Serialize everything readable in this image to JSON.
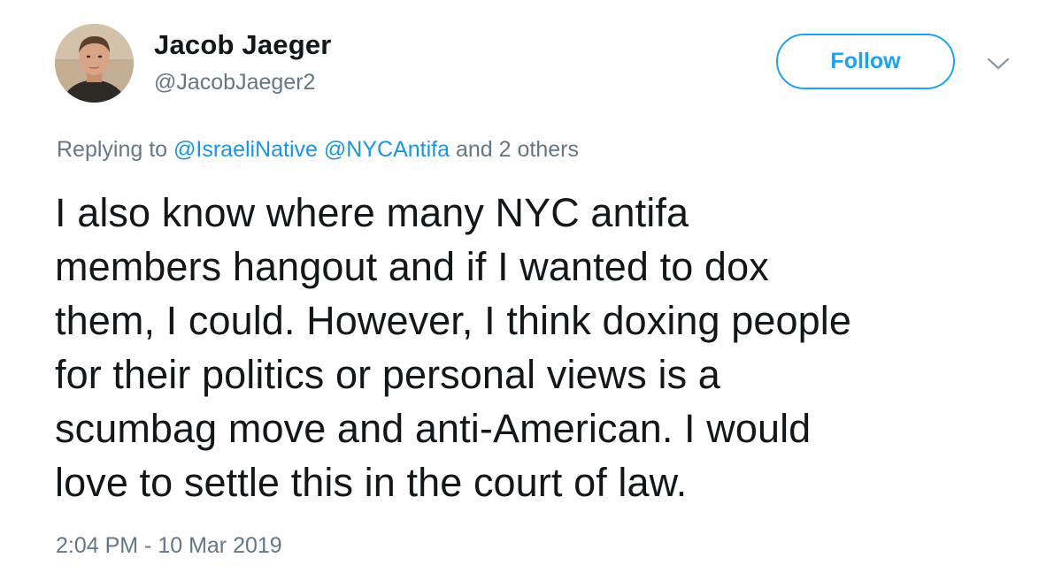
{
  "author": {
    "name": "Jacob Jaeger",
    "handle": "@JacobJaeger2",
    "avatar_icon": "user-avatar-photo"
  },
  "actions": {
    "follow_label": "Follow",
    "more_icon": "chevron-down-icon"
  },
  "reply": {
    "prefix": "Replying to",
    "mentions": [
      "@IsraeliNative",
      "@NYCAntifa"
    ],
    "suffix": "and 2 others"
  },
  "tweet": {
    "lines": [
      "I also know where many NYC antifa",
      "members hangout and if I wanted to dox",
      "them, I could. However, I think doxing people",
      "for their politics or personal views is a",
      "scumbag move and anti-American. I would",
      "love to settle this in the court of law."
    ],
    "timestamp": "2:04 PM - 10 Mar 2019"
  },
  "colors": {
    "accent": "#1da1f2",
    "mention": "#1b95e0",
    "secondary_text": "#657786",
    "primary_text": "#14171a"
  }
}
